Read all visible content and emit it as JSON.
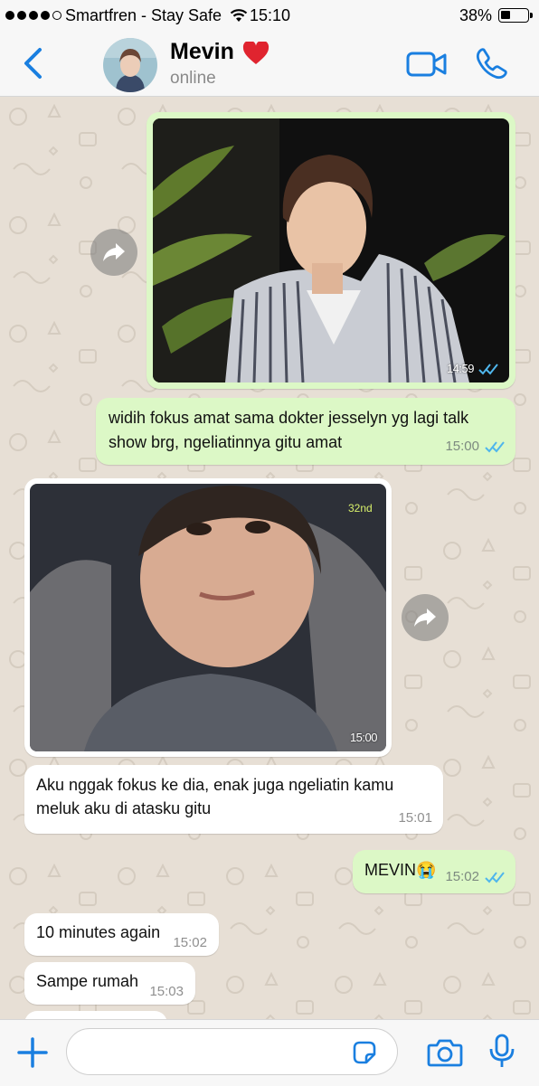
{
  "status_bar": {
    "carrier": "Smartfren - Stay Safe",
    "time": "15:10",
    "battery_percent": "38%",
    "battery_level": 0.38,
    "signal_bars": 4,
    "signal_bars_total": 5
  },
  "header": {
    "contact_name": "Mevin",
    "name_emoji": "heart-icon",
    "status": "online",
    "icons": [
      "back-chevron-icon",
      "video-camera-icon",
      "phone-icon"
    ]
  },
  "messages": [
    {
      "type": "image",
      "direction": "outgoing",
      "time": "14:59",
      "read": true,
      "description_icon": "photo"
    },
    {
      "type": "text",
      "direction": "outgoing",
      "lines": [
        "widih fokus amat sama dokter jesselyn yg lagi talk",
        "show brg, ngeliatinnya gitu amat"
      ],
      "time": "15:00",
      "read": true
    },
    {
      "type": "image",
      "direction": "incoming",
      "time": "15:00",
      "overlay_text": "32nd"
    },
    {
      "type": "text",
      "direction": "incoming",
      "lines": [
        "Aku nggak fokus ke dia, enak juga ngeliatin kamu",
        "meluk aku di atasku gitu"
      ],
      "time": "15:01"
    },
    {
      "type": "text",
      "direction": "outgoing",
      "lines": [
        "MEVIN😭"
      ],
      "time": "15:02",
      "read": true
    },
    {
      "type": "text",
      "direction": "incoming",
      "lines": [
        "10 minutes again"
      ],
      "time": "15:02"
    },
    {
      "type": "text",
      "direction": "incoming",
      "lines": [
        "Sampe rumah"
      ],
      "time": "15:03"
    }
  ],
  "colors": {
    "accent": "#1a7fe0",
    "outgoing_bubble": "#dcf8c6",
    "incoming_bubble": "#ffffff",
    "read_ticks": "#4fb6ec",
    "chat_background": "#e7dfd5"
  },
  "input_bar": {
    "placeholder": "",
    "icons": [
      "plus-icon",
      "sticker-icon",
      "camera-icon",
      "microphone-icon"
    ]
  }
}
